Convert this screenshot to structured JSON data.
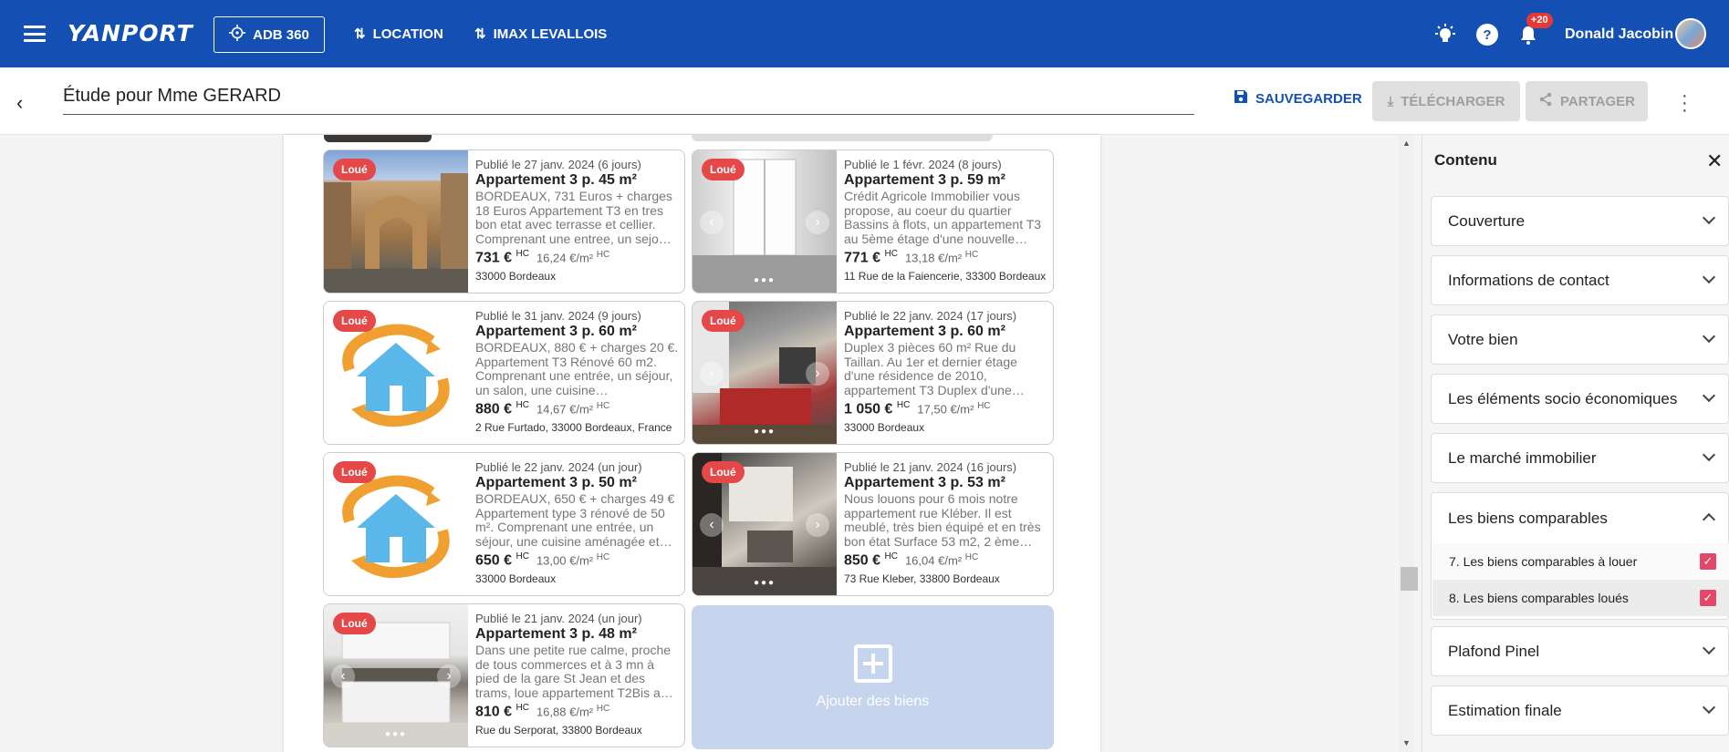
{
  "topbar": {
    "logo": "YANPORT",
    "adb_label": "ADB 360",
    "nav": [
      "LOCATION",
      "IMAX LEVALLOIS"
    ],
    "notif_badge": "+20",
    "user_name": "Donald Jacobin"
  },
  "subbar": {
    "title": "Étude pour Mme GERARD",
    "save_label": "SAUVEGARDER",
    "download_label": "TÉLÉCHARGER",
    "share_label": "PARTAGER"
  },
  "listings": [
    {
      "badge": "Loué",
      "published": "Publié le 27 janv. 2024 (6 jours)",
      "title": "Appartement 3 p. 45 m²",
      "desc": "BORDEAUX, 731 Euros + charges 18 Euros Appartement T3 en tres bon etat avec terrasse et cellier. Comprenant une entree, un sejo…",
      "price": "731 €",
      "price_unit": "HC",
      "ppm": "16,24 €/m²",
      "ppm_unit": "HC",
      "address": "33000 Bordeaux",
      "image": "photo-gate"
    },
    {
      "badge": "Loué",
      "published": "Publié le 1 févr. 2024 (8 jours)",
      "title": "Appartement 3 p. 59 m²",
      "desc": "Crédit Agricole Immobilier vous propose, au coeur du quartier Bassins à flots, un appartement T3 au 5ème étage d'une nouvelle…",
      "price": "771 €",
      "price_unit": "HC",
      "ppm": "13,18 €/m²",
      "ppm_unit": "HC",
      "address": "11 Rue de la Faiencerie, 33300 Bordeaux",
      "image": "photo-window"
    },
    {
      "badge": "Loué",
      "published": "Publié le 31 janv. 2024 (9 jours)",
      "title": "Appartement 3 p. 60 m²",
      "desc": "BORDEAUX, 880 € + charges 20 €. Appartement T3 Rénové 60 m2. Comprenant une entrée, un séjour, un salon, une cuisine…",
      "price": "880 €",
      "price_unit": "HC",
      "ppm": "14,67 €/m²",
      "ppm_unit": "HC",
      "address": "2 Rue Furtado, 33000 Bordeaux, France",
      "image": "house-logo"
    },
    {
      "badge": "Loué",
      "published": "Publié le 22 janv. 2024 (17 jours)",
      "title": "Appartement 3 p. 60 m²",
      "desc": "Duplex 3 pièces 60 m² Rue du Taillan. Au 1er et dernier étage d'une résidence de 2010, appartement T3 Duplex d'une…",
      "price": "1 050 €",
      "price_unit": "HC",
      "ppm": "17,50 €/m²",
      "ppm_unit": "HC",
      "address": "33000 Bordeaux",
      "image": "photo-living"
    },
    {
      "badge": "Loué",
      "published": "Publié le 22 janv. 2024 (un jour)",
      "title": "Appartement 3 p. 50 m²",
      "desc": "BORDEAUX, 650 € + charges 49 € Appartement type 3 rénové de 50 m². Comprenant une entrée, un séjour, une cuisine aménagée et…",
      "price": "650 €",
      "price_unit": "HC",
      "ppm": "13,00 €/m²",
      "ppm_unit": "HC",
      "address": "33000 Bordeaux",
      "image": "house-logo"
    },
    {
      "badge": "Loué",
      "published": "Publié le 21 janv. 2024 (16 jours)",
      "title": "Appartement 3 p. 53 m²",
      "desc": "Nous louons pour 6 mois notre appartement rue Kléber. Il est meublé, très bien équipé et en très bon état  Surface 53 m2, 2 ème…",
      "price": "850 €",
      "price_unit": "HC",
      "ppm": "16,04 €/m²",
      "ppm_unit": "HC",
      "address": "73 Rue Kleber, 33800 Bordeaux",
      "image": "photo-room"
    },
    {
      "badge": "Loué",
      "published": "Publié le 21 janv. 2024 (un jour)",
      "title": "Appartement 3 p. 48 m²",
      "desc": "Dans une petite rue calme, proche de tous commerces et à 3 mn à pied de la gare St Jean et des trams, loue appartement T2Bis a…",
      "price": "810 €",
      "price_unit": "HC",
      "ppm": "16,88 €/m²",
      "ppm_unit": "HC",
      "address": "Rue du Serporat, 33800 Bordeaux",
      "image": "photo-kitchen"
    }
  ],
  "add_card_label": "Ajouter des biens",
  "panel": {
    "title": "Contenu",
    "sections": [
      "Couverture",
      "Informations de contact",
      "Votre bien",
      "Les éléments socio économiques",
      "Le marché immobilier"
    ],
    "open_section": {
      "label": "Les biens comparables",
      "items": [
        "7. Les biens comparables à louer",
        "8. Les biens comparables loués"
      ]
    },
    "after_sections": [
      "Plafond Pinel",
      "Estimation finale"
    ]
  },
  "colors": {
    "brand": "#1450b4",
    "badge": "#e44848",
    "checkbox": "#e44867"
  }
}
